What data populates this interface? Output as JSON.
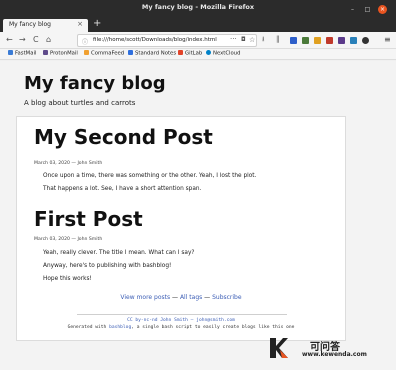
{
  "window": {
    "title": "My fancy blog - Mozilla Firefox"
  },
  "tab": {
    "label": "My fancy blog",
    "close": "×"
  },
  "newtab": "+",
  "nav": {
    "back": "←",
    "forward": "→",
    "reload": "C",
    "home": "⌂",
    "url": "file:///home/scott/Downloads/blog/index.html",
    "dots": "···",
    "star": "☆",
    "menu": "≡"
  },
  "bookmarks": [
    {
      "label": "FastMail",
      "color": "#3a7bd5"
    },
    {
      "label": "ProtonMail",
      "color": "#5f4b8b"
    },
    {
      "label": "CommaFeed",
      "color": "#f0a030"
    },
    {
      "label": "Standard Notes",
      "color": "#2f6fde"
    },
    {
      "label": "GitLab",
      "color": "#e24329"
    },
    {
      "label": "NextCloud",
      "color": "#0082c9"
    }
  ],
  "blog": {
    "title": "My fancy blog",
    "subtitle": "A blog about turtles and carrots"
  },
  "posts": [
    {
      "title": "My Second Post",
      "date": "March 03, 2020",
      "author": "John Smith",
      "paragraphs": [
        "Once upon a time, there was something or the other. Yeah, I lost the plot.",
        "That happens a lot. See, I have a short attention span."
      ]
    },
    {
      "title": "First Post",
      "date": "March 03, 2020",
      "author": "John Smith",
      "paragraphs": [
        "Yeah, really clever. The title I mean. What can I say?",
        "Anyway, here's to publishing with bashblog!",
        "Hope this works!"
      ]
    }
  ],
  "links": {
    "view_more": "View more posts",
    "sep1": " — ",
    "all_tags": "All tags",
    "sep2": " — ",
    "subscribe": "Subscribe"
  },
  "footer": {
    "license": "CC by-nc-nd John Smith — john@smith.com",
    "generated_prefix": "Generated with ",
    "generated_link": "bashblog",
    "generated_suffix": ", a single bash script to easily create blogs like this one"
  },
  "watermark": {
    "cn": "可问答",
    "url": "www.kewenda.com"
  },
  "colors": {
    "accent": "#e95420",
    "link": "#3b5db5"
  }
}
